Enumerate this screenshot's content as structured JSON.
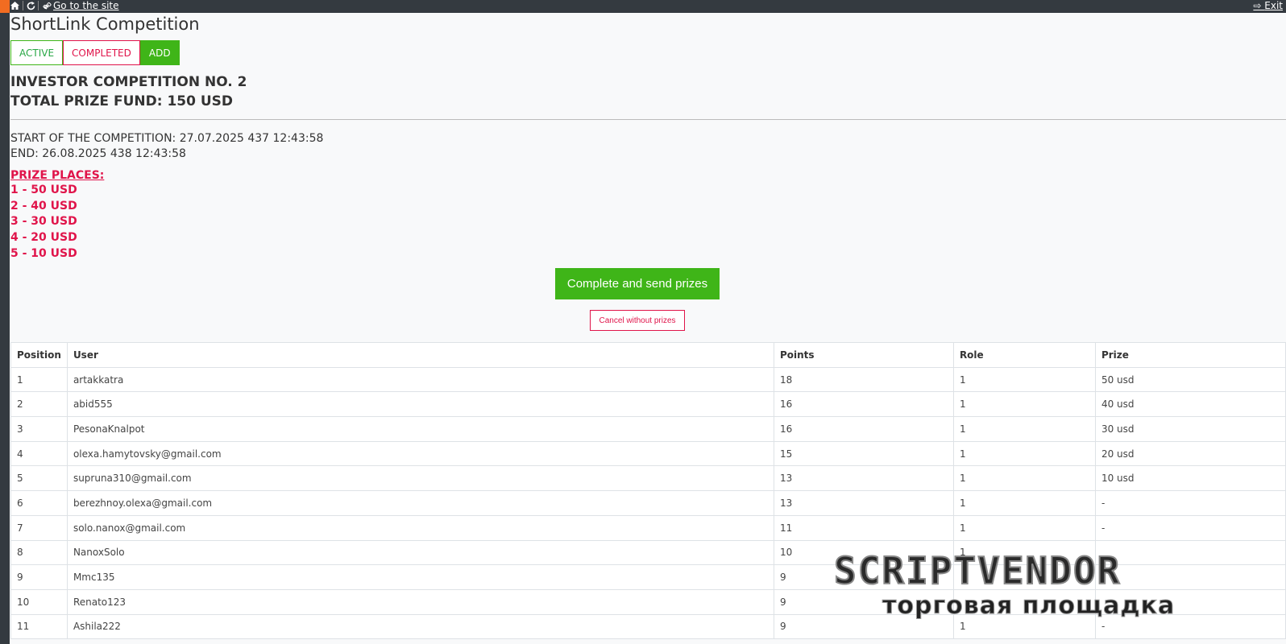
{
  "topbar": {
    "goto_label": "Go to the site",
    "exit_label": "Exit",
    "accent_color": "#f26c21"
  },
  "page": {
    "title": "ShortLink Competition"
  },
  "tabs": [
    {
      "label": "ACTIVE"
    },
    {
      "label": "COMPLETED"
    },
    {
      "label": "ADD"
    }
  ],
  "competition": {
    "title": "INVESTOR COMPETITION NO. 2",
    "fund": "TOTAL PRIZE FUND: 150 USD",
    "start": "START OF THE COMPETITION: 27.07.2025 437 12:43:58",
    "end": "END: 26.08.2025 438 12:43:58",
    "prize_heading": "PRIZE PLACES:",
    "prizes": [
      "1 - 50 USD",
      "2 - 40 USD",
      "3 - 30 USD",
      "4 - 20 USD",
      "5 - 10 USD"
    ]
  },
  "actions": {
    "complete_label": "Complete and send prizes",
    "cancel_label": "Cancel without prizes"
  },
  "table": {
    "headers": [
      "Position",
      "User",
      "Points",
      "Role",
      "Prize"
    ],
    "rows": [
      [
        "1",
        "artakkatra",
        "18",
        "1",
        "50 usd"
      ],
      [
        "2",
        "abid555",
        "16",
        "1",
        "40 usd"
      ],
      [
        "3",
        "PesonaKnalpot",
        "16",
        "1",
        "30 usd"
      ],
      [
        "4",
        "olexa.hamytovsky@gmail.com",
        "15",
        "1",
        "20 usd"
      ],
      [
        "5",
        "supruna310@gmail.com",
        "13",
        "1",
        "10 usd"
      ],
      [
        "6",
        "berezhnoy.olexa@gmail.com",
        "13",
        "1",
        "-"
      ],
      [
        "7",
        "solo.nanox@gmail.com",
        "11",
        "1",
        "-"
      ],
      [
        "8",
        "NanoxSolo",
        "10",
        "1",
        ""
      ],
      [
        "9",
        "Mmc135",
        "9",
        "",
        ""
      ],
      [
        "10",
        "Renato123",
        "9",
        "",
        ""
      ],
      [
        "11",
        "Ashila222",
        "9",
        "1",
        "-"
      ]
    ]
  },
  "watermark": {
    "top": "SCRIPTVENDOR",
    "bottom": "торговая площадка"
  },
  "colors": {
    "green": "#3fb518",
    "red": "#e0144a",
    "dark": "#343a40"
  }
}
